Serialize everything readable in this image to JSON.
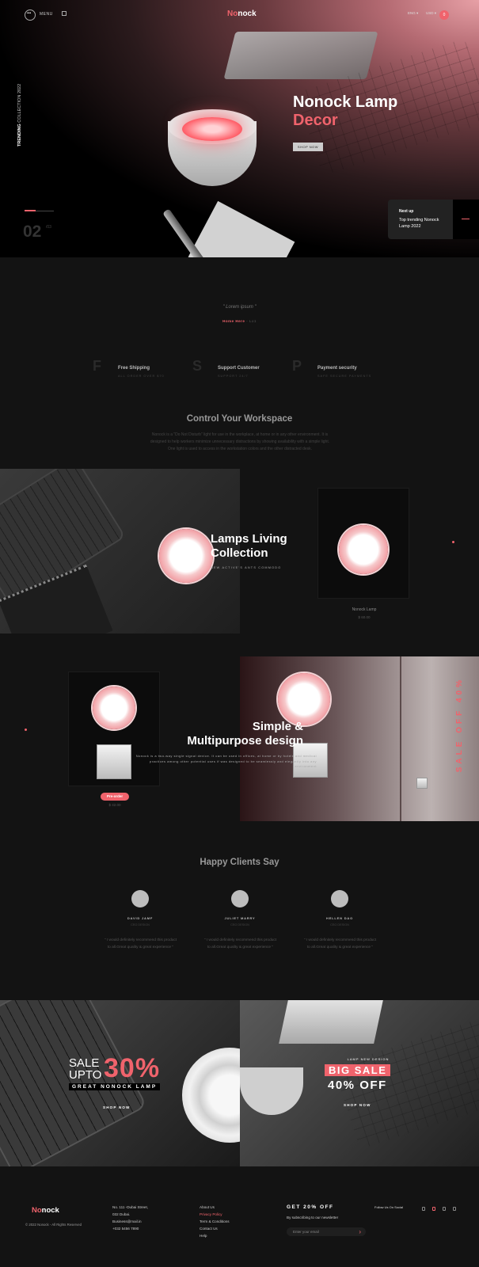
{
  "header": {
    "menu_label": "MENU",
    "logo_first": "No",
    "logo_rest": "nock",
    "lang": "ENG",
    "currency": "USD",
    "cart_count": "0"
  },
  "hero": {
    "trending": "TRENDING",
    "collection": "COLLECTION 2022",
    "slide_num": "02",
    "slide_total": "/03",
    "title_line1": "Nonock Lamp",
    "title_line2": "Decor",
    "button": "SHOP NOW",
    "next_label": "Next up",
    "next_title": "Top trending Nonock Lamp 2022"
  },
  "intro": {
    "quote": "\" Lorem ipsum \"",
    "crumb_a": "Home Here",
    "crumb_b": "- Lo1"
  },
  "features": [
    {
      "letter": "F",
      "title": "Free Shipping",
      "sub": "ALL ORDER OVER $70"
    },
    {
      "letter": "S",
      "title": "Support Customer",
      "sub": "SUPPORT 24/7"
    },
    {
      "letter": "P",
      "title": "Payment security",
      "sub": "SAFE SECURE PAYMENTS"
    }
  ],
  "workspace": {
    "heading": "Control Your Workspace",
    "text": "Nonock is a \"Do Not Disturb\" light for use in the workplace, at home or in any other environment. It is designed to help workers minimize unnecessary distractions by showing availability with a simple light. One light is used to access in the workstation colors and the other distracted desk."
  },
  "living": {
    "title_line1": "Lamps Living",
    "title_line2": "Collection",
    "sub": "NEW ACTIVE'S ANTS COMMODO",
    "product_name": "Nonock Lamp",
    "product_price": "$ 60.00"
  },
  "simple": {
    "title_line1": "Simple &",
    "title_line2": "Multipurpose design",
    "text": "Nonock is a two-way single signal device. It can be used in offices, at home or by hotels and medical practices among other potential uses if was designed to be seamlessly and elegantly into any environment",
    "badge": "Pre-order",
    "price": "$ 42.00",
    "sale": "SALE OFF 40%"
  },
  "testimonials": {
    "heading": "Happy Clients Say",
    "items": [
      {
        "name": "DAVID JAMF",
        "role": "CEO DESIGN",
        "text": "\" I would definitely recommend this product to all.Great quality & great experience \""
      },
      {
        "name": "JULIET MARRY",
        "role": "CEO DESIGN",
        "text": "\" I would definitely recommend this product to all.Great quality & great experience \""
      },
      {
        "name": "HELLEN DAO",
        "role": "CEO DESIGN",
        "text": "\" I would definitely recommend this product to all.Great quality & great experience \""
      }
    ]
  },
  "banners": {
    "left_sale": "SALE",
    "left_upto": "UPTO",
    "left_pct": "30%",
    "left_tag": "GREAT NONOCK LAMP",
    "left_btn": "SHOP NOW",
    "right_small": "LAMP NEW DESIGN",
    "right_big": "BIG SALE",
    "right_pct": "40% OFF",
    "right_btn": "SHOP NOW"
  },
  "footer": {
    "logo_first": "No",
    "logo_rest": "nock",
    "copyright": "© 2022 Nonock - All Rights Reserved",
    "address": [
      "No. 111 -Dubai Street,",
      "032 Dubai.",
      "Business@mail.in",
      "+032 5456 7890"
    ],
    "links": [
      "About Us",
      "Privacy Policy",
      "Term & Conditions",
      "Contact Us",
      "Help"
    ],
    "newsletter_head": "GET 20% OFF",
    "newsletter_text": "By subscribing to our newsletter",
    "email_placeholder": "Enter your email",
    "social_label": "Follow Us On Social"
  },
  "colors": {
    "accent": "#f0636c",
    "bg": "#131313"
  }
}
